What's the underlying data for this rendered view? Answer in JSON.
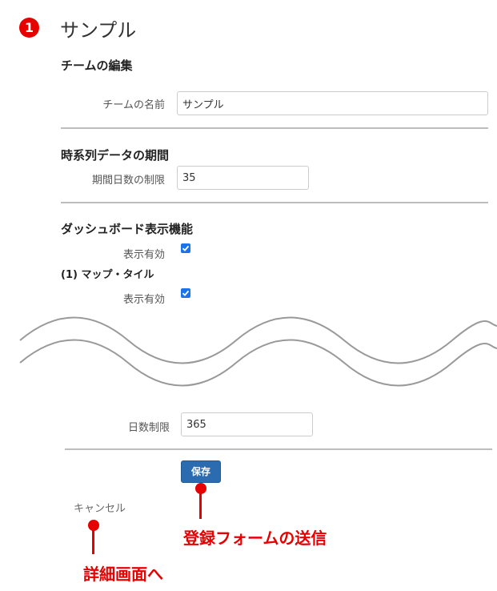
{
  "badge": {
    "number": "1"
  },
  "page": {
    "title": "サンプル"
  },
  "team_edit": {
    "heading": "チームの編集",
    "name_label": "チームの名前",
    "name_value": "サンプル"
  },
  "timeseries": {
    "heading": "時系列データの期間",
    "days_label": "期間日数の制限",
    "days_value": "35"
  },
  "dashboard": {
    "heading": "ダッシュボード表示機能",
    "enabled_label": "表示有効",
    "map_tile_heading": "(1) マップ・タイル",
    "map_tile_enabled_label": "表示有効"
  },
  "day_limit": {
    "label": "日数制限",
    "value": "365"
  },
  "actions": {
    "save_label": "保存",
    "cancel_label": "キャンセル"
  },
  "annotations": {
    "submit_note": "登録フォームの送信",
    "detail_note": "詳細画面へ",
    "color": "#e60000"
  },
  "colors": {
    "accent": "#2b6cb0",
    "checkbox": "#1a73e8",
    "wave": "#999999"
  }
}
